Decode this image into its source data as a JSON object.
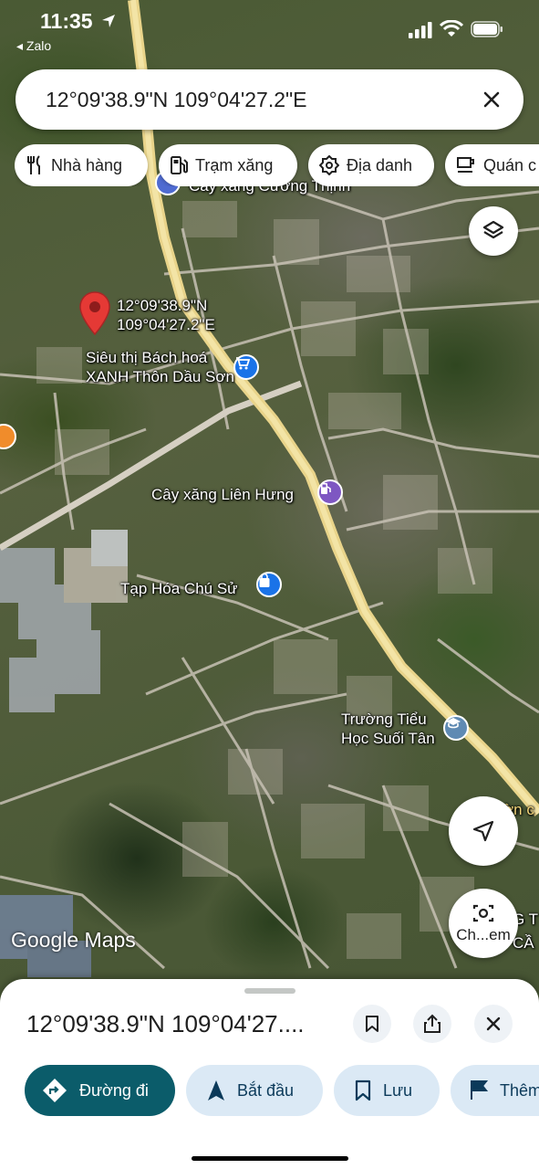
{
  "status_bar": {
    "time": "11:35",
    "back_app": "◂ Zalo"
  },
  "search": {
    "value": "12°09'38.9\"N 109°04'27.2\"E"
  },
  "chips": [
    {
      "label": "Nhà hàng",
      "icon": "restaurant-icon"
    },
    {
      "label": "Trạm xăng",
      "icon": "gas-station-icon"
    },
    {
      "label": "Địa danh",
      "icon": "landmark-icon"
    },
    {
      "label": "Quán c",
      "icon": "cafe-icon"
    }
  ],
  "map": {
    "pin_label_line1": "12°09'38.9\"N",
    "pin_label_line2": "109°04'27.2\"E",
    "labels": {
      "gas_top": "Cây xăng Cường Thịnh",
      "supermarket_line1": "Siêu thị Bách hoá",
      "supermarket_line2": "XANH Thôn Dầu Sơn",
      "gas_lien_hung": "Cây xăng Liên Hưng",
      "tap_hoa": "Tạp Hóa Chú Sử",
      "school_line1": "Trường Tiểu",
      "school_line2": "Học Suối Tân",
      "edge_right_1": "ờn c",
      "edge_right_2": "G T",
      "edge_right_3": "CẦ",
      "edge_bottom_1": "Ch...em"
    },
    "attribution": "Google Maps",
    "colors": {
      "pin": "#e53935",
      "supermarket": "#1a73e8",
      "gas": "#7e57c2",
      "school": "#5f8ab3"
    }
  },
  "sheet": {
    "title": "12°09'38.9\"N 109°04'27....",
    "actions": {
      "directions": "Đường đi",
      "start": "Bắt đầu",
      "save": "Lưu",
      "more": "Thêm"
    },
    "accent": "#0b5c6a"
  }
}
